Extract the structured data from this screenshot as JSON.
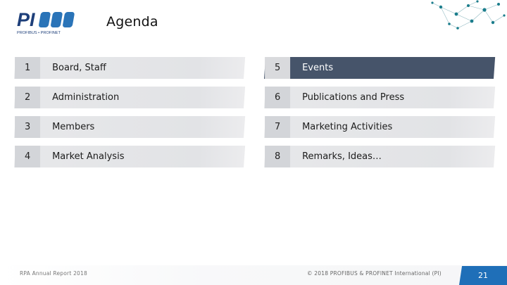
{
  "header": {
    "logo_text": "PI",
    "logo_subtext": "PROFIBUS • PROFINET",
    "title": "Agenda"
  },
  "agenda": {
    "left": [
      {
        "number": "1",
        "label": "Board, Staff"
      },
      {
        "number": "2",
        "label": "Administration"
      },
      {
        "number": "3",
        "label": "Members"
      },
      {
        "number": "4",
        "label": "Market Analysis"
      }
    ],
    "right": [
      {
        "number": "5",
        "label": "Events",
        "active": true
      },
      {
        "number": "6",
        "label": "Publications and Press"
      },
      {
        "number": "7",
        "label": "Marketing Activities"
      },
      {
        "number": "8",
        "label": "Remarks, Ideas…"
      }
    ]
  },
  "footer": {
    "left_text": "RPA Annual Report 2018",
    "right_text": "© 2018 PROFIBUS & PROFINET International (PI)",
    "page_number": "21"
  },
  "colors": {
    "active_row": "#46546a",
    "page_badge": "#1f6fb8",
    "network_nodes": "#1b7d8c"
  }
}
